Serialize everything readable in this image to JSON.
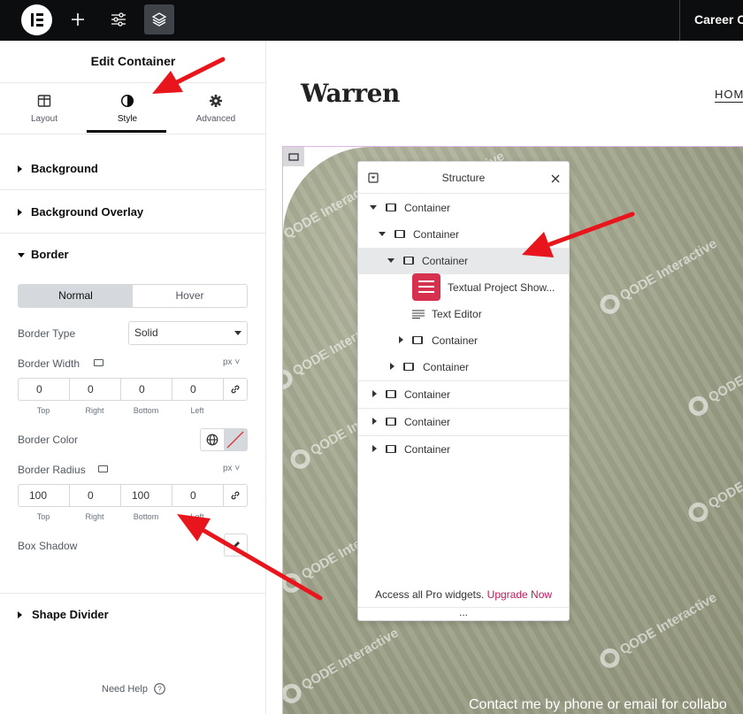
{
  "topbar": {
    "logo": "elementor-logo",
    "buttons": [
      "add-icon",
      "site-settings-icon",
      "structure-icon"
    ],
    "page_title": "Career C"
  },
  "panel": {
    "title": "Edit Container",
    "tabs": [
      {
        "label": "Layout",
        "icon": "layout-icon"
      },
      {
        "label": "Style",
        "icon": "style-icon"
      },
      {
        "label": "Advanced",
        "icon": "gear-icon"
      }
    ],
    "active_tab": "Style",
    "sections": {
      "background": "Background",
      "background_overlay": "Background Overlay",
      "border": "Border",
      "shape_divider": "Shape Divider"
    },
    "state_toggle": {
      "normal": "Normal",
      "hover": "Hover",
      "selected": "Normal"
    },
    "border_type": {
      "label": "Border Type",
      "value": "Solid"
    },
    "border_width": {
      "label": "Border Width",
      "unit": "px",
      "values": [
        "0",
        "0",
        "0",
        "0"
      ],
      "sides": [
        "Top",
        "Right",
        "Bottom",
        "Left"
      ]
    },
    "border_color": {
      "label": "Border Color"
    },
    "border_radius": {
      "label": "Border Radius",
      "unit": "px",
      "values": [
        "100",
        "0",
        "100",
        "0"
      ],
      "sides": [
        "Top",
        "Right",
        "Bottom",
        "Left"
      ]
    },
    "box_shadow": {
      "label": "Box Shadow"
    },
    "need_help": "Need Help"
  },
  "preview": {
    "brand": "Warren",
    "nav_link": "HOM",
    "watermark": "QODE Interactive",
    "contact_text": "Contact me by phone or email for collabo"
  },
  "structure": {
    "title": "Structure",
    "nodes": [
      {
        "label": "Container",
        "expanded": true
      },
      {
        "label": "Container",
        "expanded": true
      },
      {
        "label": "Container",
        "expanded": true,
        "selected": true
      },
      {
        "label": "Textual Project Show..."
      },
      {
        "label": "Text Editor"
      },
      {
        "label": "Container",
        "expanded": false
      },
      {
        "label": "Container",
        "expanded": false
      },
      {
        "label": "Container",
        "expanded": false
      },
      {
        "label": "Container",
        "expanded": false
      },
      {
        "label": "Container",
        "expanded": false
      }
    ],
    "footer_text": "Access all Pro widgets.",
    "upgrade_label": "Upgrade Now",
    "dots": "..."
  },
  "colors": {
    "topbar": "#0c0d0e",
    "upgrade": "#c2185b",
    "annotation_arrow": "#e8161c",
    "widget_icon": "#d6314f"
  }
}
